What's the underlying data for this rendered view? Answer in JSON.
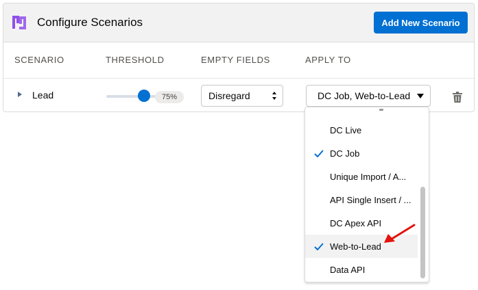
{
  "header": {
    "title": "Configure Scenarios",
    "add_button": "Add New Scenario"
  },
  "columns": [
    "SCENARIO",
    "THRESHOLD",
    "EMPTY FIELDS",
    "APPLY TO"
  ],
  "row": {
    "scenario": "Lead",
    "threshold_percent": 75,
    "threshold_label": "75%",
    "empty_fields": "Disregard",
    "apply_to": "DC Job, Web-to-Lead"
  },
  "dropdown": {
    "options": [
      {
        "label": "DC Live",
        "checked": false
      },
      {
        "label": "DC Job",
        "checked": true
      },
      {
        "label": "Unique Import / A...",
        "checked": false
      },
      {
        "label": "API Single Insert / ...",
        "checked": false
      },
      {
        "label": "DC Apex API",
        "checked": false
      },
      {
        "label": "Web-to-Lead",
        "checked": true
      },
      {
        "label": "Data API",
        "checked": false
      }
    ]
  },
  "colors": {
    "brand": "#0070d2",
    "logo": "#9050e9",
    "annotation_arrow": "#e3120b"
  },
  "icons": [
    "logo-icon",
    "chevron-right-icon",
    "updown-icon",
    "caret-down-icon",
    "trash-icon",
    "check-icon",
    "annotation-arrow"
  ]
}
